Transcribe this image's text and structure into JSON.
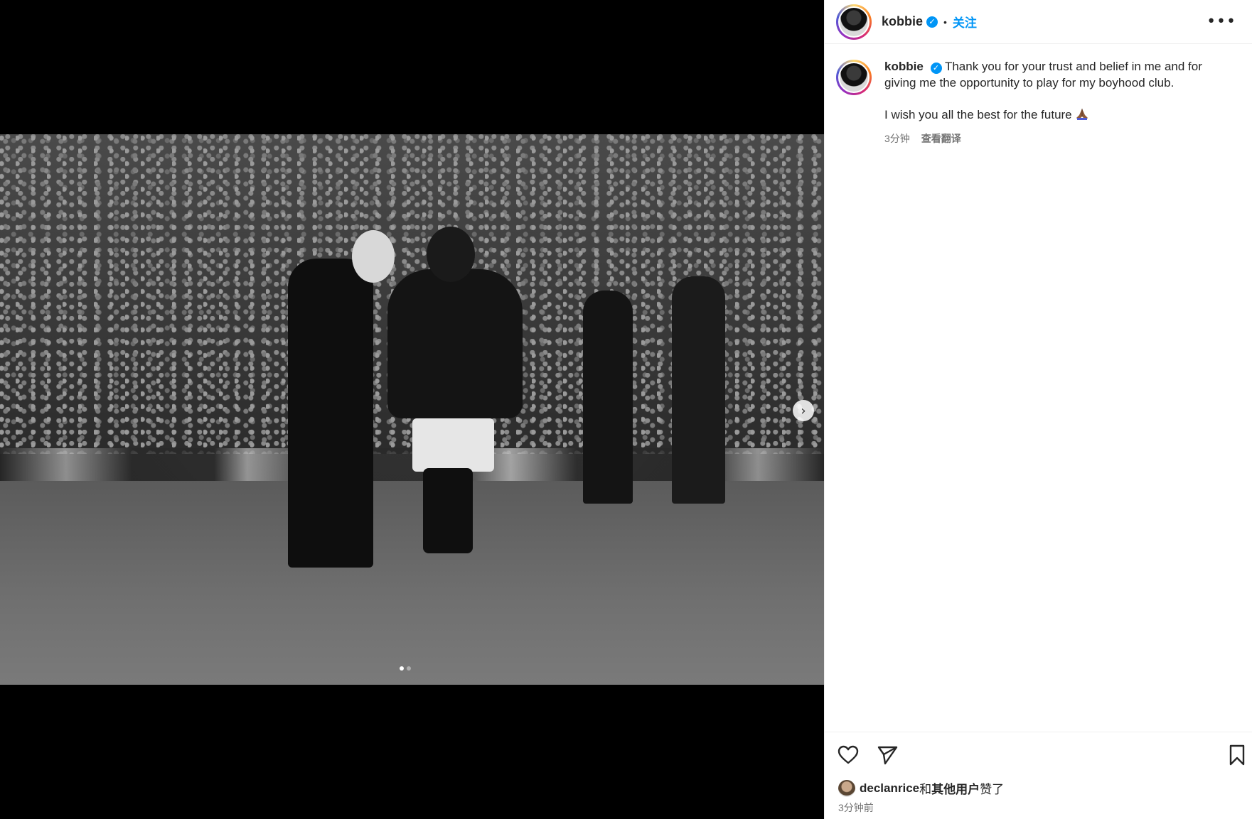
{
  "post": {
    "username": "kobbie",
    "separator": "•",
    "follow_label": "关注",
    "more_label": "•••"
  },
  "caption": {
    "username": "kobbie",
    "text_line1": "Thank you for your trust and belief in me and for giving me the opportunity to play for my boyhood club.",
    "text_line2": "I wish you all the best for the future",
    "time": "3分钟",
    "translate_label": "查看翻译"
  },
  "media": {
    "slide_count": 2,
    "active_slide": 1,
    "next_label": "›"
  },
  "likes": {
    "first_user": "declanrice",
    "connector": "和",
    "others": "其他用户",
    "suffix": "赞了",
    "time": "3分钟前"
  },
  "colors": {
    "accent": "#0095f6",
    "text": "#262626",
    "muted": "#737373"
  }
}
